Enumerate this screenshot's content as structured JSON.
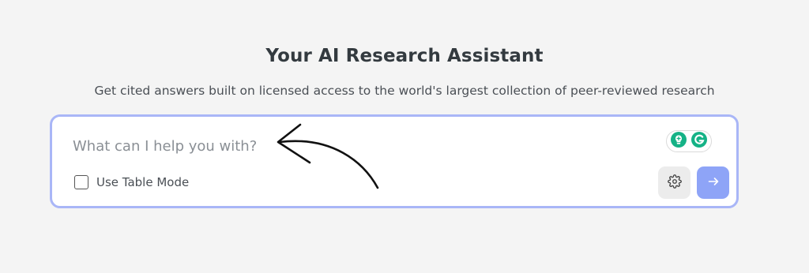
{
  "header": {
    "title": "Your AI Research Assistant",
    "subtitle": "Get cited answers built on licensed access to the world's largest collection of peer-reviewed research"
  },
  "search": {
    "placeholder": "What can I help you with?",
    "value": "",
    "table_mode_label": "Use Table Mode",
    "table_mode_checked": false
  },
  "icons": {
    "extension_bulb": "lightbulb-plus-icon",
    "extension_grammarly": "grammarly-g-icon",
    "settings": "gear-icon",
    "submit": "arrow-right-icon",
    "annotation": "hand-drawn-arrow"
  },
  "colors": {
    "background": "#f4f4f4",
    "card_border": "#a9b6f7",
    "submit_bg": "#8ea4f7",
    "settings_bg": "#ececec",
    "title": "#333a3f",
    "extension_green": "#15b286"
  }
}
